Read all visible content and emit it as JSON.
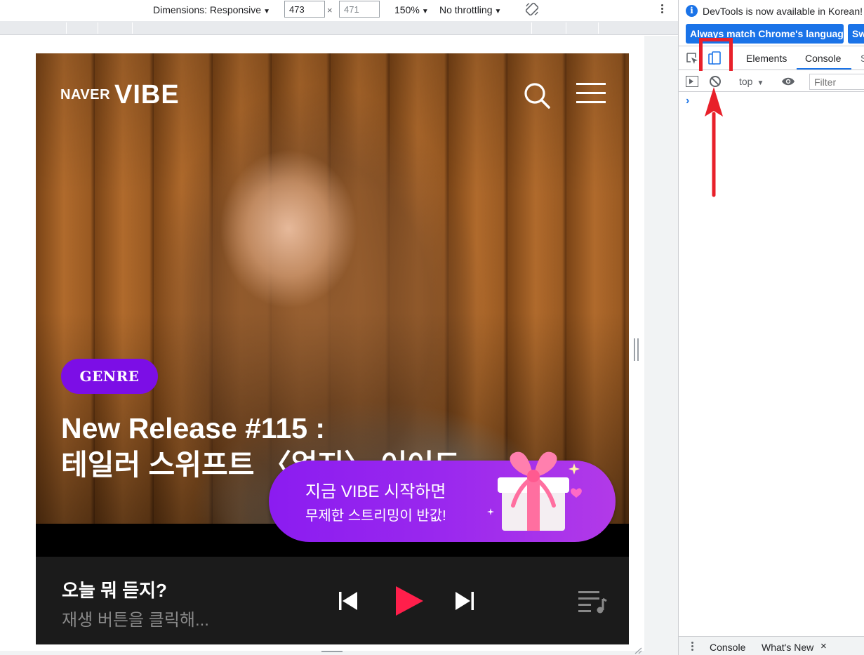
{
  "device_toolbar": {
    "dimensions_label": "Dimensions: Responsive",
    "width_value": "473",
    "height_value": "471",
    "times_sign": "×",
    "zoom": "150%",
    "throttling": "No throttling"
  },
  "vibe": {
    "logo_naver": "NAVER",
    "logo_vibe": "VIBE",
    "genre_badge": "GENRE",
    "title_line1": "New Release #115 :",
    "title_line2": "테일러 스위프트 〈얼지〉 어어드",
    "promo_line1": "지금 VIBE 시작하면",
    "promo_line2": "무제한 스트리밍이 반값!",
    "now_playing_title": "오늘 뭐 듣지?",
    "now_playing_sub": "재생 버튼을 클릭해...",
    "colors": {
      "badge": "#7c0ee6",
      "play": "#ff1f4b",
      "promo": "#8b1cf0",
      "player_bg": "#1b1b1b"
    }
  },
  "devtools": {
    "info_text": "DevTools is now available in Korean!",
    "match_language_button": "Always match Chrome's language",
    "switch_button": "Sw",
    "tabs": [
      "Elements",
      "Console",
      "S"
    ],
    "active_tab": "Console",
    "context": "top",
    "filter_placeholder": "Filter",
    "prompt": "›",
    "drawer_tabs": [
      "Console",
      "What's New"
    ],
    "drawer_close": "×",
    "highlight_color": "#e8202a",
    "accent": "#1a73e8"
  },
  "icons": [
    "rotate-icon",
    "more-options-icon",
    "search-icon",
    "hamburger-menu-icon",
    "gift-icon",
    "skip-previous-icon",
    "play-icon",
    "skip-next-icon",
    "playlist-icon",
    "info-icon",
    "inspect-element-icon",
    "device-toggle-icon",
    "sidebar-icon",
    "clear-console-icon",
    "eye-icon",
    "arrow-up-annotation"
  ]
}
